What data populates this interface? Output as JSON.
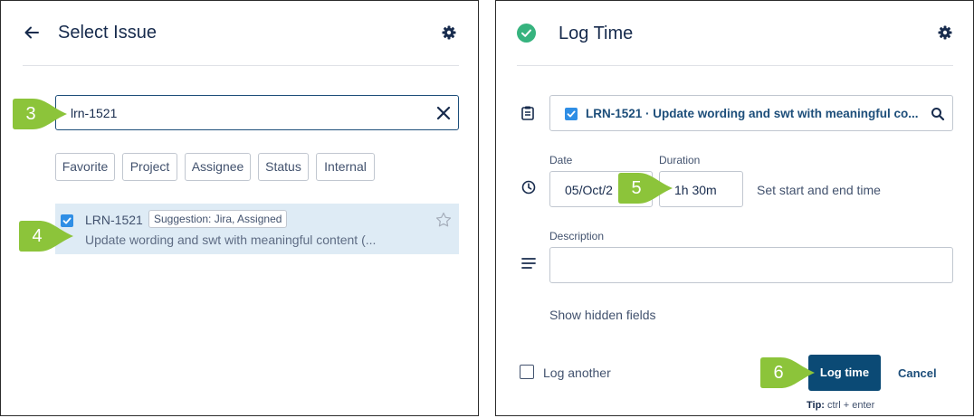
{
  "left": {
    "title": "Select Issue",
    "search": {
      "value": "lrn-1521"
    },
    "filters": [
      "Favorite",
      "Project",
      "Assignee",
      "Status",
      "Internal"
    ],
    "result": {
      "key": "LRN-1521",
      "badge": "Suggestion: Jira, Assigned",
      "summary": "Update wording and swt with meaningful content (..."
    }
  },
  "right": {
    "title": "Log Time",
    "issue": "LRN-1521 · Update wording and swt with meaningful co...",
    "date_label": "Date",
    "date_value": "05/Oct/2",
    "duration_label": "Duration",
    "duration_value": "1h 30m",
    "set_start_end": "Set start and end time",
    "description_label": "Description",
    "show_hidden": "Show hidden fields",
    "log_another": "Log another",
    "log_time_button": "Log time",
    "cancel_button": "Cancel",
    "tip_bold": "Tip:",
    "tip_keys": "ctrl + enter"
  },
  "markers": {
    "m3": "3",
    "m4": "4",
    "m5": "5",
    "m6": "6"
  },
  "colors": {
    "accent": "#0b4a75",
    "check": "#2f8ee5",
    "success": "#36b37e",
    "marker": "#8cc43a",
    "selected_row": "#deebf5"
  }
}
